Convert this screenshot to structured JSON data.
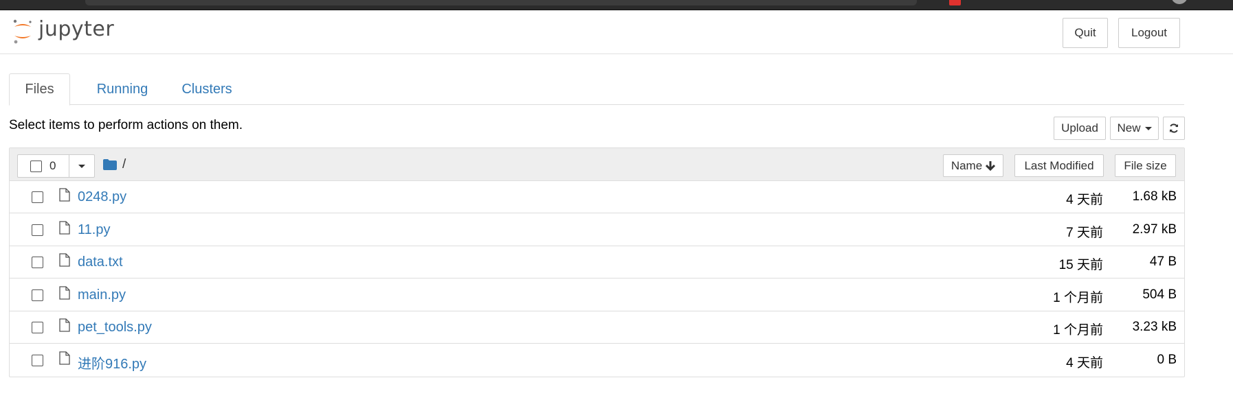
{
  "header": {
    "logo_text": "jupyter",
    "quit_label": "Quit",
    "logout_label": "Logout"
  },
  "tabs": [
    {
      "label": "Files",
      "active": true
    },
    {
      "label": "Running",
      "active": false
    },
    {
      "label": "Clusters",
      "active": false
    }
  ],
  "toolbar": {
    "instruction": "Select items to perform actions on them.",
    "upload_label": "Upload",
    "new_label": "New"
  },
  "list_header": {
    "selected_count": "0",
    "breadcrumb": "/",
    "sort_name_label": "Name",
    "sort_modified_label": "Last Modified",
    "sort_size_label": "File size"
  },
  "files": [
    {
      "name": "0248.py",
      "modified": "4 天前",
      "size": "1.68 kB"
    },
    {
      "name": "11.py",
      "modified": "7 天前",
      "size": "2.97 kB"
    },
    {
      "name": "data.txt",
      "modified": "15 天前",
      "size": "47 B"
    },
    {
      "name": "main.py",
      "modified": "1 个月前",
      "size": "504 B"
    },
    {
      "name": "pet_tools.py",
      "modified": "1 个月前",
      "size": "3.23 kB"
    },
    {
      "name": "进阶916.py",
      "modified": "4 天前",
      "size": "0 B"
    }
  ],
  "colors": {
    "link": "#337ab7",
    "logo_orange": "#f37726",
    "folder": "#337ab7"
  },
  "icons": [
    "jupyter-logo-icon",
    "folder-icon",
    "file-icon",
    "arrow-down-icon",
    "caret-down-icon",
    "refresh-icon"
  ]
}
